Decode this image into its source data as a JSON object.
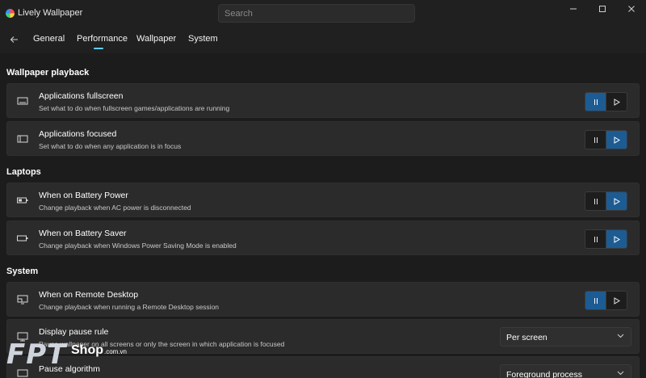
{
  "window": {
    "title": "Lively Wallpaper",
    "icons": [
      "lively-logo-icon",
      "minimize-icon",
      "maximize-icon",
      "close-icon"
    ]
  },
  "search": {
    "placeholder": "Search"
  },
  "nav": {
    "back_icon": "back-arrow-icon",
    "tabs": [
      {
        "label": "General",
        "active": false
      },
      {
        "label": "Performance",
        "active": true
      },
      {
        "label": "Wallpaper",
        "active": false
      },
      {
        "label": "System",
        "active": false
      }
    ],
    "accent_color": "#60cdff"
  },
  "sections": [
    {
      "title": "Wallpaper playback",
      "items": [
        {
          "icon": "fullscreen-icon",
          "title": "Applications fullscreen",
          "desc": "Set what to do when fullscreen games/applications are running",
          "control": "toggle",
          "selected": "pause"
        },
        {
          "icon": "window-focus-icon",
          "title": "Applications focused",
          "desc": "Set what to do when any application is in focus",
          "control": "toggle",
          "selected": "play"
        }
      ]
    },
    {
      "title": "Laptops",
      "items": [
        {
          "icon": "battery-icon",
          "title": "When on Battery Power",
          "desc": "Change playback when AC power is disconnected",
          "control": "toggle",
          "selected": "play"
        },
        {
          "icon": "battery-saver-icon",
          "title": "When on Battery Saver",
          "desc": "Change playback when Windows Power Saving Mode is enabled",
          "control": "toggle",
          "selected": "play"
        }
      ]
    },
    {
      "title": "System",
      "items": [
        {
          "icon": "remote-desktop-icon",
          "title": "When on Remote Desktop",
          "desc": "Change playback when running a Remote Desktop session",
          "control": "toggle",
          "selected": "pause"
        },
        {
          "icon": "monitor-icon",
          "title": "Display pause rule",
          "desc": "Pause wallpaper on all screens or only the screen in which application is focused",
          "control": "dropdown",
          "value": "Per screen"
        },
        {
          "icon": "algorithm-icon",
          "title": "Pause algorithm",
          "desc": "",
          "control": "dropdown",
          "value": "Foreground process"
        }
      ]
    }
  ],
  "toggle_icons": {
    "pause": "pause-icon",
    "play": "play-icon"
  },
  "colors": {
    "toggle_active": "#1d5b93",
    "card_bg": "#2b2b2b",
    "window_bg": "#202020"
  },
  "watermark": {
    "logo": "FPT",
    "shop": "Shop",
    "domain": ".com.vn"
  }
}
